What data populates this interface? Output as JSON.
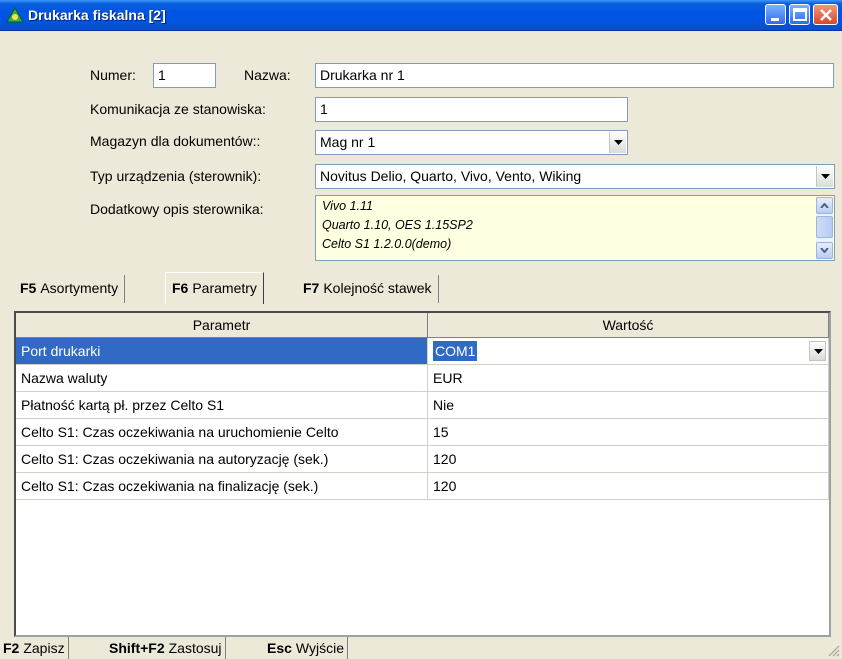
{
  "window": {
    "title": "Drukarka fiskalna [2]"
  },
  "form": {
    "numer_label": "Numer:",
    "numer_value": "1",
    "nazwa_label": "Nazwa:",
    "nazwa_value": "Drukarka nr 1",
    "komunikacja_label": "Komunikacja ze stanowiska:",
    "komunikacja_value": "1",
    "magazyn_label": "Magazyn dla dokumentów::",
    "magazyn_value": "Mag nr 1",
    "typ_label": "Typ urządzenia (sterownik):",
    "typ_value": "Novitus Delio, Quarto, Vivo, Vento, Wiking",
    "opis_label": "Dodatkowy opis sterownika:",
    "opis_lines": [
      "Vivo 1.11",
      "Quarto 1.10, OES 1.15SP2",
      "Celto S1 1.2.0.0(demo)"
    ]
  },
  "tabs": [
    {
      "key": "F5",
      "label": "Asortymenty"
    },
    {
      "key": "F6",
      "label": "Parametry"
    },
    {
      "key": "F7",
      "label": "Kolejność stawek"
    }
  ],
  "active_tab": "Parametry",
  "grid": {
    "headers": [
      "Parametr",
      "Wartość"
    ],
    "rows": [
      {
        "param": "Port drukarki",
        "value": "COM1"
      },
      {
        "param": "Nazwa waluty",
        "value": "EUR"
      },
      {
        "param": "Płatność kartą pł. przez Celto S1",
        "value": "Nie"
      },
      {
        "param": "Celto S1: Czas oczekiwania na uruchomienie Celto",
        "value": "15"
      },
      {
        "param": "Celto S1: Czas oczekiwania na autoryzację (sek.)",
        "value": "120"
      },
      {
        "param": "Celto S1: Czas oczekiwania na finalizację (sek.)",
        "value": "120"
      }
    ]
  },
  "shortcuts": [
    {
      "key": "F2",
      "label": "Zapisz"
    },
    {
      "key": "Shift+F2",
      "label": "Zastosuj"
    },
    {
      "key": "Esc",
      "label": "Wyjście"
    }
  ],
  "colors": {
    "titlebar": "#0054e3",
    "selection": "#316ac5",
    "memo_background": "#ffffe1",
    "window_background": "#ece9d8"
  },
  "icons": [
    "app-icon",
    "minimize-icon",
    "maximize-icon",
    "close-icon",
    "dropdown-arrow-icon",
    "scroll-up-icon",
    "scroll-down-icon",
    "resize-grip-icon"
  ]
}
